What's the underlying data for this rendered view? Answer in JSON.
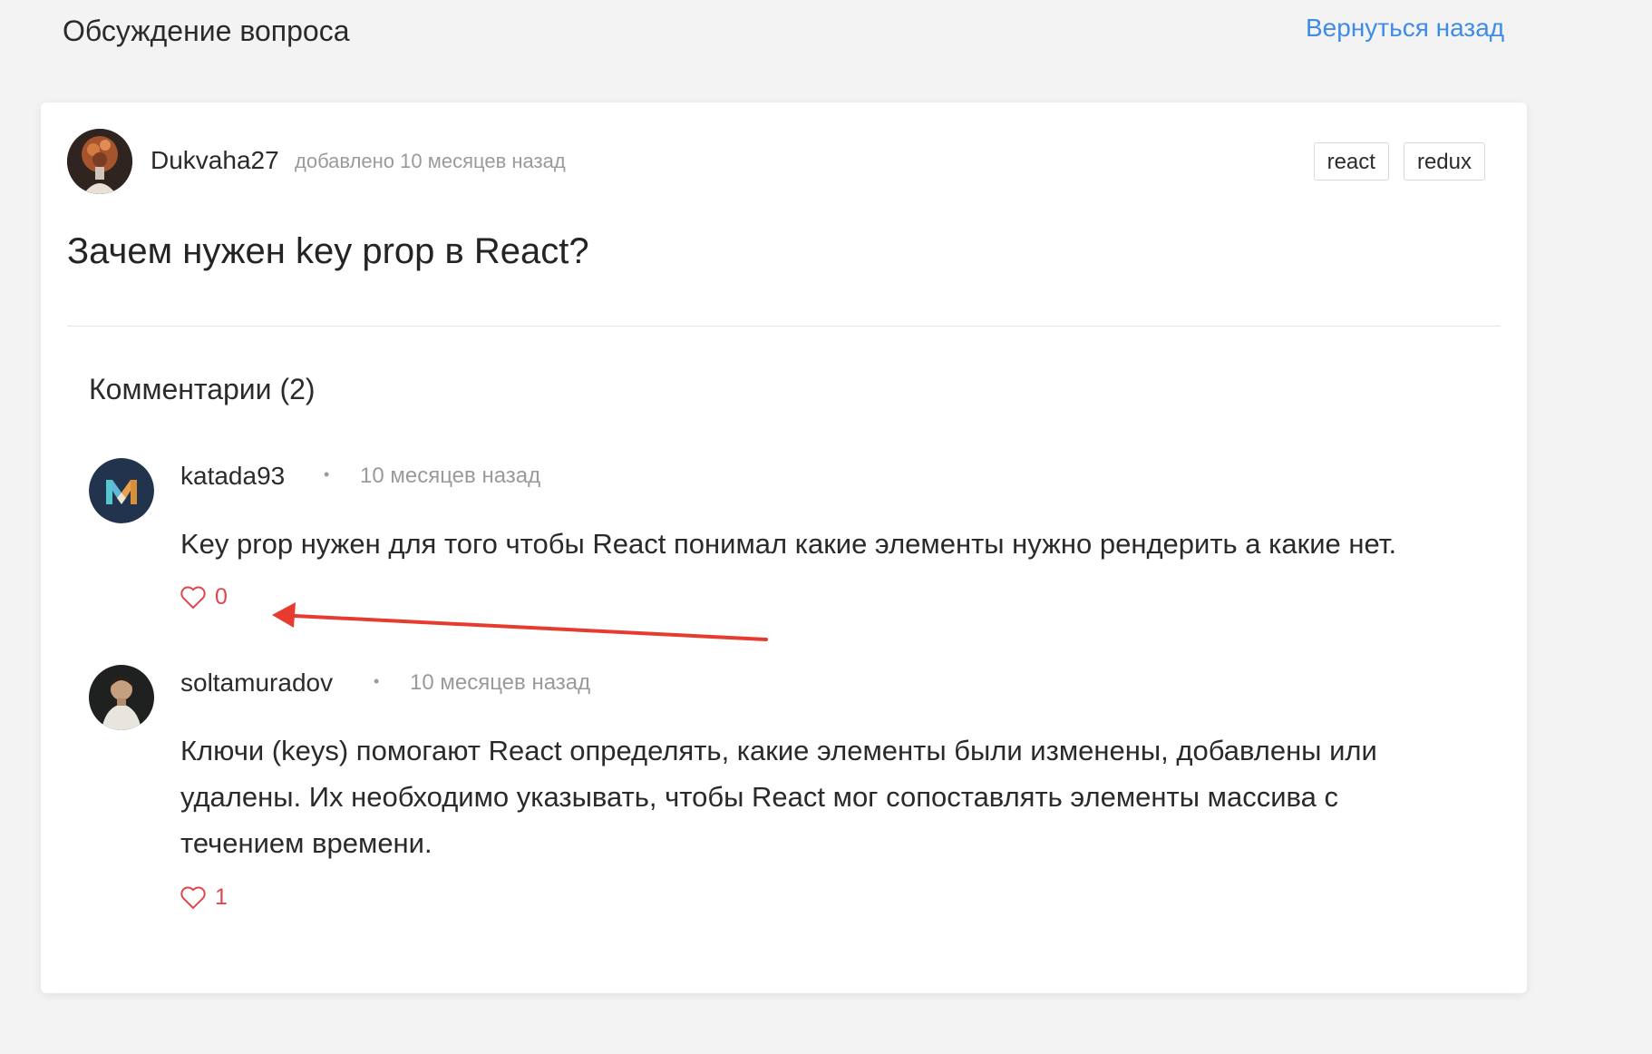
{
  "header": {
    "title": "Обсуждение вопроса",
    "back_link": "Вернуться назад"
  },
  "post": {
    "author": "Dukvaha27",
    "date": "добавлено 10 месяцев назад",
    "tags": [
      "react",
      "redux"
    ],
    "title": "Зачем нужен key prop в React?"
  },
  "comments_section": {
    "heading": "Комментарии (2)",
    "items": [
      {
        "author": "katada93",
        "date": "10 месяцев назад",
        "text": "Key prop нужен для того чтобы React понимал какие элементы нужно рендерить а какие нет.",
        "likes": "0"
      },
      {
        "author": "soltamuradov",
        "date": "10 месяцев назад",
        "text": "Ключи (keys) помогают React определять, какие элементы были изменены, добавлены или удалены. Их необходимо указывать, чтобы React мог сопоставлять элементы массива с течением времени.",
        "likes": "1"
      }
    ]
  },
  "colors": {
    "link": "#3f8ce8",
    "like": "#e0464d",
    "annotation_arrow": "#e63b2e"
  },
  "icons": {
    "like": "heart-icon",
    "separator": "dot-separator"
  }
}
